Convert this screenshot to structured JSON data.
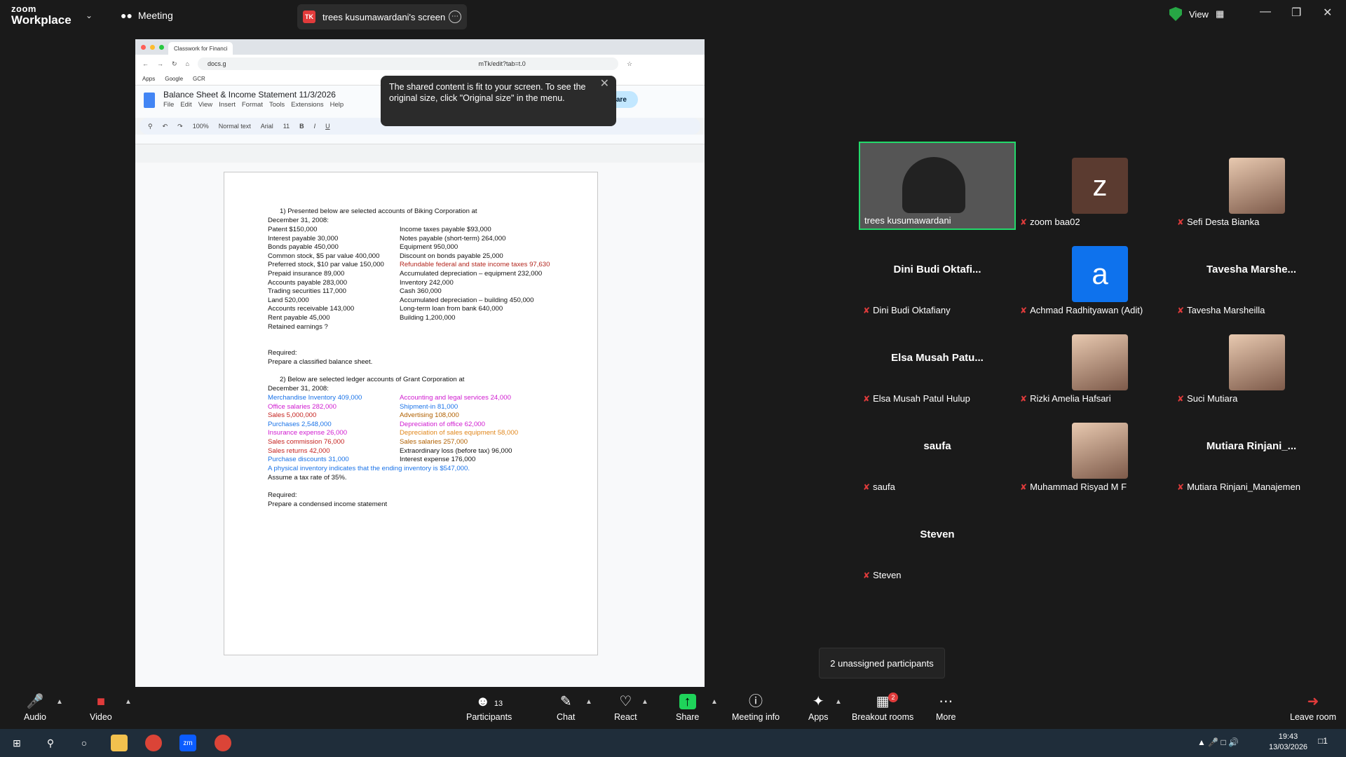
{
  "topbar": {
    "logo_top": "zoom",
    "logo_bottom": "Workplace",
    "meeting_label": "Meeting",
    "share_badge": "TK",
    "share_title": "trees kusumawardani's screen",
    "view_label": "View"
  },
  "browser": {
    "tab_label": "Classwork for Financi",
    "url": "docs.g",
    "url_tail": "mTk/edit?tab=t.0",
    "bookmarks": [
      "Apps",
      "Google",
      "GCR"
    ]
  },
  "tooltip": {
    "text": "The shared content is fit to your screen. To see the original size, click \"Original size\" in the menu."
  },
  "docs": {
    "title": "Balance Sheet & Income Statement 11/3/2026",
    "menu": [
      "File",
      "Edit",
      "View",
      "Insert",
      "Format",
      "Tools",
      "Extensions",
      "Help"
    ],
    "share_label": "Share",
    "zoom": "100%",
    "style": "Normal text",
    "font": "Arial",
    "size": "11"
  },
  "document": {
    "q1_heading": "1)   Presented below are selected accounts of Biking Corporation at",
    "q1_date": "December 31, 2008:",
    "q1_left": [
      "Patent $150,000",
      "Interest payable 30,000",
      "Bonds payable 450,000",
      "Common stock, $5 par value 400,000",
      "Preferred stock, $10 par value 150,000",
      "Prepaid insurance 89,000",
      "Accounts payable 283,000",
      "Trading securities 117,000",
      "Land 520,000",
      "Accounts receivable 143,000",
      "Rent payable 45,000",
      "Retained earnings ?"
    ],
    "q1_right": [
      "Income taxes payable $93,000",
      "Notes payable (short-term) 264,000",
      "Equipment 950,000",
      "Discount on bonds payable 25,000",
      "Refundable federal and state income taxes 97,630",
      "Accumulated depreciation – equipment 232,000",
      "Inventory 242,000",
      "Cash 360,000",
      "Accumulated depreciation – building 450,000",
      "Long-term loan from bank 640,000",
      "Building 1,200,000"
    ],
    "q1_required": "Required:",
    "q1_task": "Prepare a classified balance sheet.",
    "q2_heading": "2)   Below are selected ledger accounts of Grant Corporation at",
    "q2_date": "December 31, 2008:",
    "q2_left": [
      "Merchandise Inventory 409,000",
      "Office salaries 282,000",
      "Sales 5,000,000",
      "Purchases 2,548,000",
      "Insurance expense 26,000",
      "Sales commission 76,000",
      "Sales returns 42,000",
      "Purchase discounts 31,000"
    ],
    "q2_right": [
      "Accounting and legal services 24,000",
      "Shipment-in 81,000",
      "Advertising 108,000",
      "Depreciation of office 62,000",
      "Depreciation of sales equipment 58,000",
      "Sales salaries 257,000",
      "Extraordinary loss (before tax) 96,000",
      "Interest expense 176,000"
    ],
    "q2_note": "A physical inventory indicates that the ending inventory is $547,000.",
    "q2_tax": "Assume a tax rate of 35%.",
    "q2_required": "Required:",
    "q2_task": "Prepare a condensed income statement"
  },
  "participants": [
    {
      "tile": "trees kusumawardani",
      "type": "video"
    },
    {
      "tile": "zoom baa02",
      "letter": "z",
      "color": "#5b3b30"
    },
    {
      "tile": "Sefi Desta Bianka",
      "type": "photo"
    },
    {
      "big": "Dini Budi Oktafi...",
      "tile": "Dini Budi Oktafiany"
    },
    {
      "tile": "Achmad Radhityawan (Adit)",
      "letter": "a",
      "color": "#0e72ed"
    },
    {
      "big": "Tavesha Marshe...",
      "tile": "Tavesha Marsheilla"
    },
    {
      "big": "Elsa Musah Patu...",
      "tile": "Elsa Musah Patul Hulup"
    },
    {
      "tile": "Rizki Amelia Hafsari",
      "type": "photo"
    },
    {
      "tile": "Suci Mutiara",
      "type": "photo"
    },
    {
      "big": "saufa",
      "tile": "saufa"
    },
    {
      "tile": "Muhammad Risyad M F",
      "type": "photo"
    },
    {
      "big": "Mutiara Rinjani_...",
      "tile": "Mutiara Rinjani_Manajemen"
    },
    {
      "big": "Steven",
      "tile": "Steven"
    }
  ],
  "unassigned": "2 unassigned participants",
  "toolbar": {
    "audio": "Audio",
    "video": "Video",
    "participants": "Participants",
    "participants_count": "13",
    "chat": "Chat",
    "react": "React",
    "share": "Share",
    "meeting_info": "Meeting info",
    "apps": "Apps",
    "breakout": "Breakout rooms",
    "breakout_badge": "2",
    "more": "More",
    "leave": "Leave room"
  },
  "taskbar": {
    "time": "19:43",
    "date": "13/03/2026",
    "notifications": "1"
  }
}
